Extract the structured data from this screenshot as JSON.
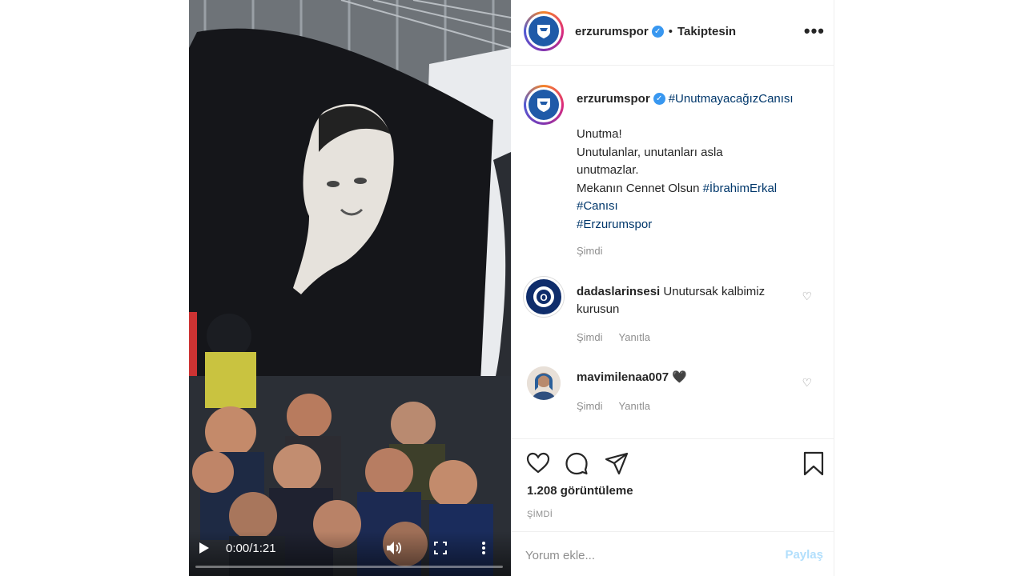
{
  "media": {
    "current_time": "0:00",
    "duration": "1:21",
    "time_separator": " / ",
    "progress": 0.0
  },
  "header": {
    "username": "erzurumspor",
    "verified": true,
    "separator": "•",
    "follow_status": "Takiptesin",
    "options_icon": "more-horizontal-icon"
  },
  "caption": {
    "username": "erzurumspor",
    "hashtag": "#UnutmayacağızCanısı",
    "lines": [
      "Unutma!",
      "Unutulanlar, unutanları asla",
      "unutmazlar.",
      "Mekanın Cennet Olsun",
      "#Canısı",
      "#Erzurumspor"
    ],
    "inline_hashtag": "#İbrahimErkal",
    "time": "Şimdi"
  },
  "comments": [
    {
      "username": "dadaslarinsesi",
      "text": "Unutursak kalbimiz kurusun",
      "time": "Şimdi",
      "reply": "Yanıtla"
    },
    {
      "username": "mavimilenaa007",
      "text": "🖤",
      "time": "Şimdi",
      "reply": "Yanıtla"
    }
  ],
  "actions": {
    "like_icon": "heart-icon",
    "comment_icon": "comment-icon",
    "share_icon": "paper-plane-icon",
    "save_icon": "bookmark-icon"
  },
  "stats": {
    "views": "1.208 görüntüleme",
    "post_time": "ŞİMDİ"
  },
  "comment_box": {
    "placeholder": "Yorum ekle...",
    "post_label": "Paylaş"
  },
  "colors": {
    "link": "#00376b",
    "verified": "#3897f0",
    "muted": "#8e8e8e",
    "post_disabled": "#b2dffc"
  }
}
